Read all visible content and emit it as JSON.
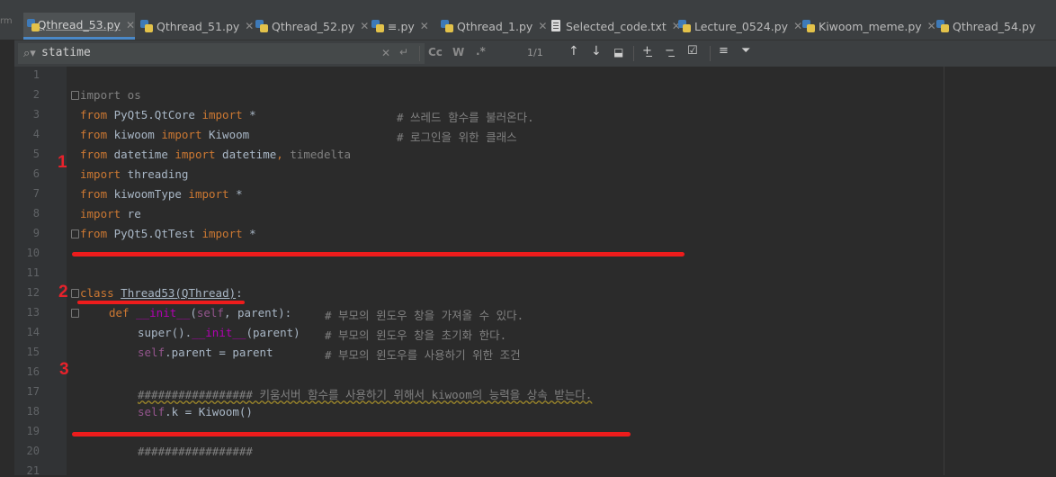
{
  "tabs": [
    {
      "label": "Qthread_53.py",
      "icon": "python-file-icon",
      "active": true,
      "closable": true
    },
    {
      "label": "Qthread_51.py",
      "icon": "python-file-icon",
      "closable": true
    },
    {
      "label": "Qthread_52.py",
      "icon": "python-file-icon",
      "closable": true
    },
    {
      "label": "≡.py",
      "icon": "python-file-icon",
      "closable": true
    },
    {
      "label": "Qthread_1.py",
      "icon": "python-file-icon",
      "closable": true
    },
    {
      "label": "Selected_code.txt",
      "icon": "text-file-icon",
      "closable": true
    },
    {
      "label": "Lecture_0524.py",
      "icon": "python-file-icon",
      "closable": true
    },
    {
      "label": "Kiwoom_meme.py",
      "icon": "python-file-icon",
      "closable": true
    },
    {
      "label": "Qthread_54.py",
      "icon": "python-file-icon",
      "closable": false
    }
  ],
  "left_edge_text": "rm",
  "search": {
    "query": "statime",
    "match_count": "1/1",
    "case_label": "Cc",
    "word_label": "W",
    "regex_label": ".*"
  },
  "lines": [
    {
      "n": "1"
    },
    {
      "n": "2"
    },
    {
      "n": "3"
    },
    {
      "n": "4"
    },
    {
      "n": "5"
    },
    {
      "n": "6"
    },
    {
      "n": "7"
    },
    {
      "n": "8"
    },
    {
      "n": "9"
    },
    {
      "n": "10"
    },
    {
      "n": "11"
    },
    {
      "n": "12"
    },
    {
      "n": "13"
    },
    {
      "n": "14"
    },
    {
      "n": "15"
    },
    {
      "n": "16"
    },
    {
      "n": "17"
    },
    {
      "n": "18"
    },
    {
      "n": "19"
    },
    {
      "n": "20"
    },
    {
      "n": "21"
    }
  ],
  "code": {
    "l2": {
      "kw1": "import",
      "rest": " os"
    },
    "l3": {
      "kw1": "from",
      "mod": " PyQt5.QtCore ",
      "kw2": "import",
      "rest": " *",
      "comment": "# 쓰레드 함수를 불러온다."
    },
    "l4": {
      "kw1": "from",
      "mod": " kiwoom ",
      "kw2": "import",
      "rest": " Kiwoom",
      "comment": "# 로그인을 위한 클래스"
    },
    "l5": {
      "kw1": "from",
      "mod": " datetime ",
      "kw2": "import",
      "rest": " datetime",
      "comma": ",",
      "gray": " timedelta"
    },
    "l6": {
      "kw1": "import",
      "rest": " threading"
    },
    "l7": {
      "kw1": "from",
      "mod": " kiwoomType ",
      "kw2": "import",
      "rest": " *"
    },
    "l8": {
      "kw1": "import",
      "rest": " re"
    },
    "l9": {
      "kw1": "from",
      "mod": " PyQt5.QtTest ",
      "kw2": "import",
      "rest": " *"
    },
    "l12": {
      "kw1": "class",
      "sp": " ",
      "cls": "Thread53",
      "paren": "(QThread)",
      "colon": ":"
    },
    "l13": {
      "kw1": "def",
      "fn": " __init__",
      "p1": "(",
      "self": "self",
      "rest": ", parent):",
      "comment": "# 부모의 윈도우 창을 가져올 수 있다."
    },
    "l14": {
      "call": "super().",
      "fn": "__init__",
      "rest": "(parent)",
      "comment": "# 부모의 윈도우 창을 초기화 한다."
    },
    "l15": {
      "self": "self",
      "rest": ".parent = parent",
      "comment": "# 부모의 윈도우를 사용하기 위한 조건"
    },
    "l17": {
      "comment": "################# 키움서버 함수를 사용하기 위해서 kiwoom의 능력을 상속 받는다."
    },
    "l18": {
      "self": "self",
      "rest": ".k = Kiwoom()"
    },
    "l20": {
      "comment": "#################"
    }
  },
  "annotations": [
    "1",
    "2",
    "3"
  ],
  "colors": {
    "background": "#2b2b2b",
    "keyword": "#cc7832",
    "comment": "#808080",
    "annotation": "#ee1c1c",
    "active_tab_underline": "#4a88c7"
  }
}
